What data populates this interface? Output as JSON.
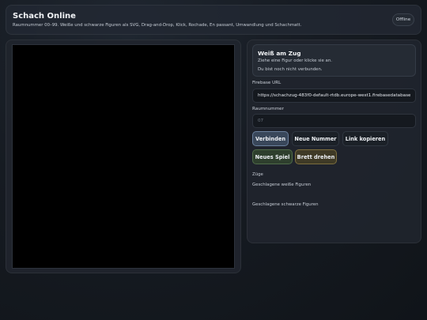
{
  "header": {
    "title": "Schach Online",
    "subtitle": "Raumnummer 00–99. Weiße und schwarze Figuren als SVG, Drag-and-Drop, Klick, Rochade, En passant, Umwandlung und Schachmatt.",
    "status": "Offline"
  },
  "turn": {
    "title": "Weiß am Zug",
    "hint": "Ziehe eine Figur oder klicke sie an.",
    "connection": "Du bist noch nicht verbunden."
  },
  "firebase": {
    "label": "Firebase URL",
    "value": "https://schachzug-483f0-default-rtdb.europe-west1.firebasedatabase.app"
  },
  "room": {
    "label": "Raumnummer",
    "placeholder": "07"
  },
  "buttons": {
    "connect": "Verbinden",
    "new_number": "Neue Nummer",
    "copy_link": "Link kopieren",
    "new_game": "Neues Spiel",
    "flip_board": "Brett drehen"
  },
  "sections": {
    "moves": "Züge",
    "captured_white": "Geschlagene weiße Figuren",
    "captured_black": "Geschlagene schwarze Figuren"
  }
}
